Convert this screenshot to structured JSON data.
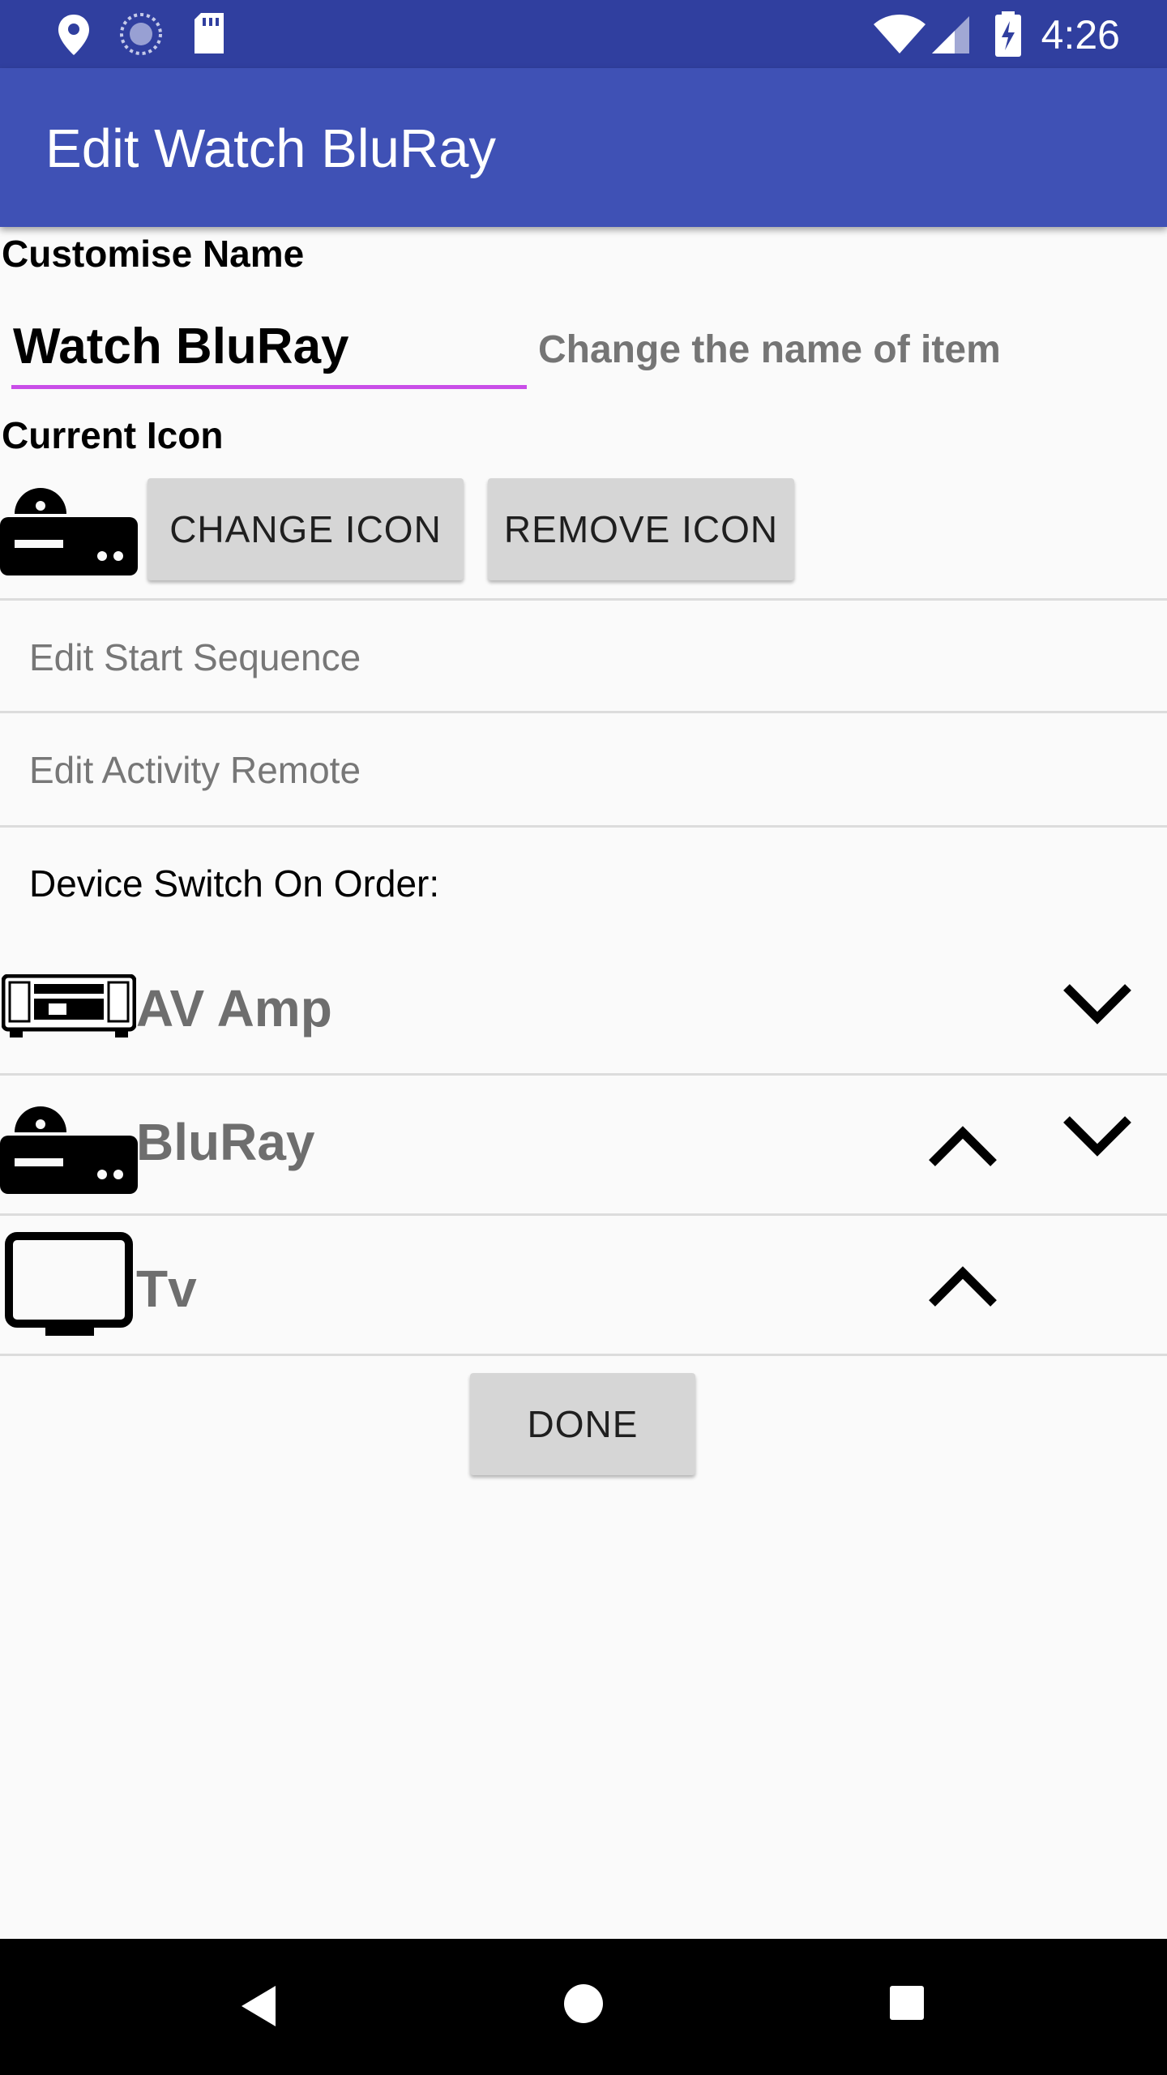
{
  "status_bar": {
    "time": "4:26",
    "left_icons": [
      "location-icon",
      "sync-icon",
      "sd-card-icon"
    ],
    "right_icons": [
      "wifi-icon",
      "cell-signal-icon",
      "battery-charging-icon"
    ]
  },
  "app_bar": {
    "title": "Edit Watch BluRay"
  },
  "customise_name": {
    "label": "Customise Name",
    "value": "Watch BluRay",
    "hint": "Change the name of item"
  },
  "current_icon": {
    "label": "Current Icon",
    "icon": "bluray-player-icon",
    "change_button": "CHANGE ICON",
    "remove_button": "REMOVE ICON"
  },
  "menu": {
    "edit_start_sequence": "Edit Start Sequence",
    "edit_activity_remote": "Edit Activity Remote"
  },
  "order": {
    "label": "Device Switch On Order:",
    "devices": [
      {
        "name": "AV Amp",
        "icon": "av-amplifier-icon",
        "can_move_up": false,
        "can_move_down": true
      },
      {
        "name": "BluRay",
        "icon": "bluray-player-icon",
        "can_move_up": true,
        "can_move_down": true
      },
      {
        "name": "Tv",
        "icon": "tv-icon",
        "can_move_up": true,
        "can_move_down": false
      }
    ]
  },
  "done_button": "DONE",
  "colors": {
    "status_bar": "#303f9f",
    "app_bar": "#3f51b5",
    "input_underline": "#c94ee8",
    "button_bg": "#d6d6d6"
  },
  "nav_bar": {
    "icons": [
      "back-icon",
      "home-icon",
      "recents-icon"
    ]
  }
}
